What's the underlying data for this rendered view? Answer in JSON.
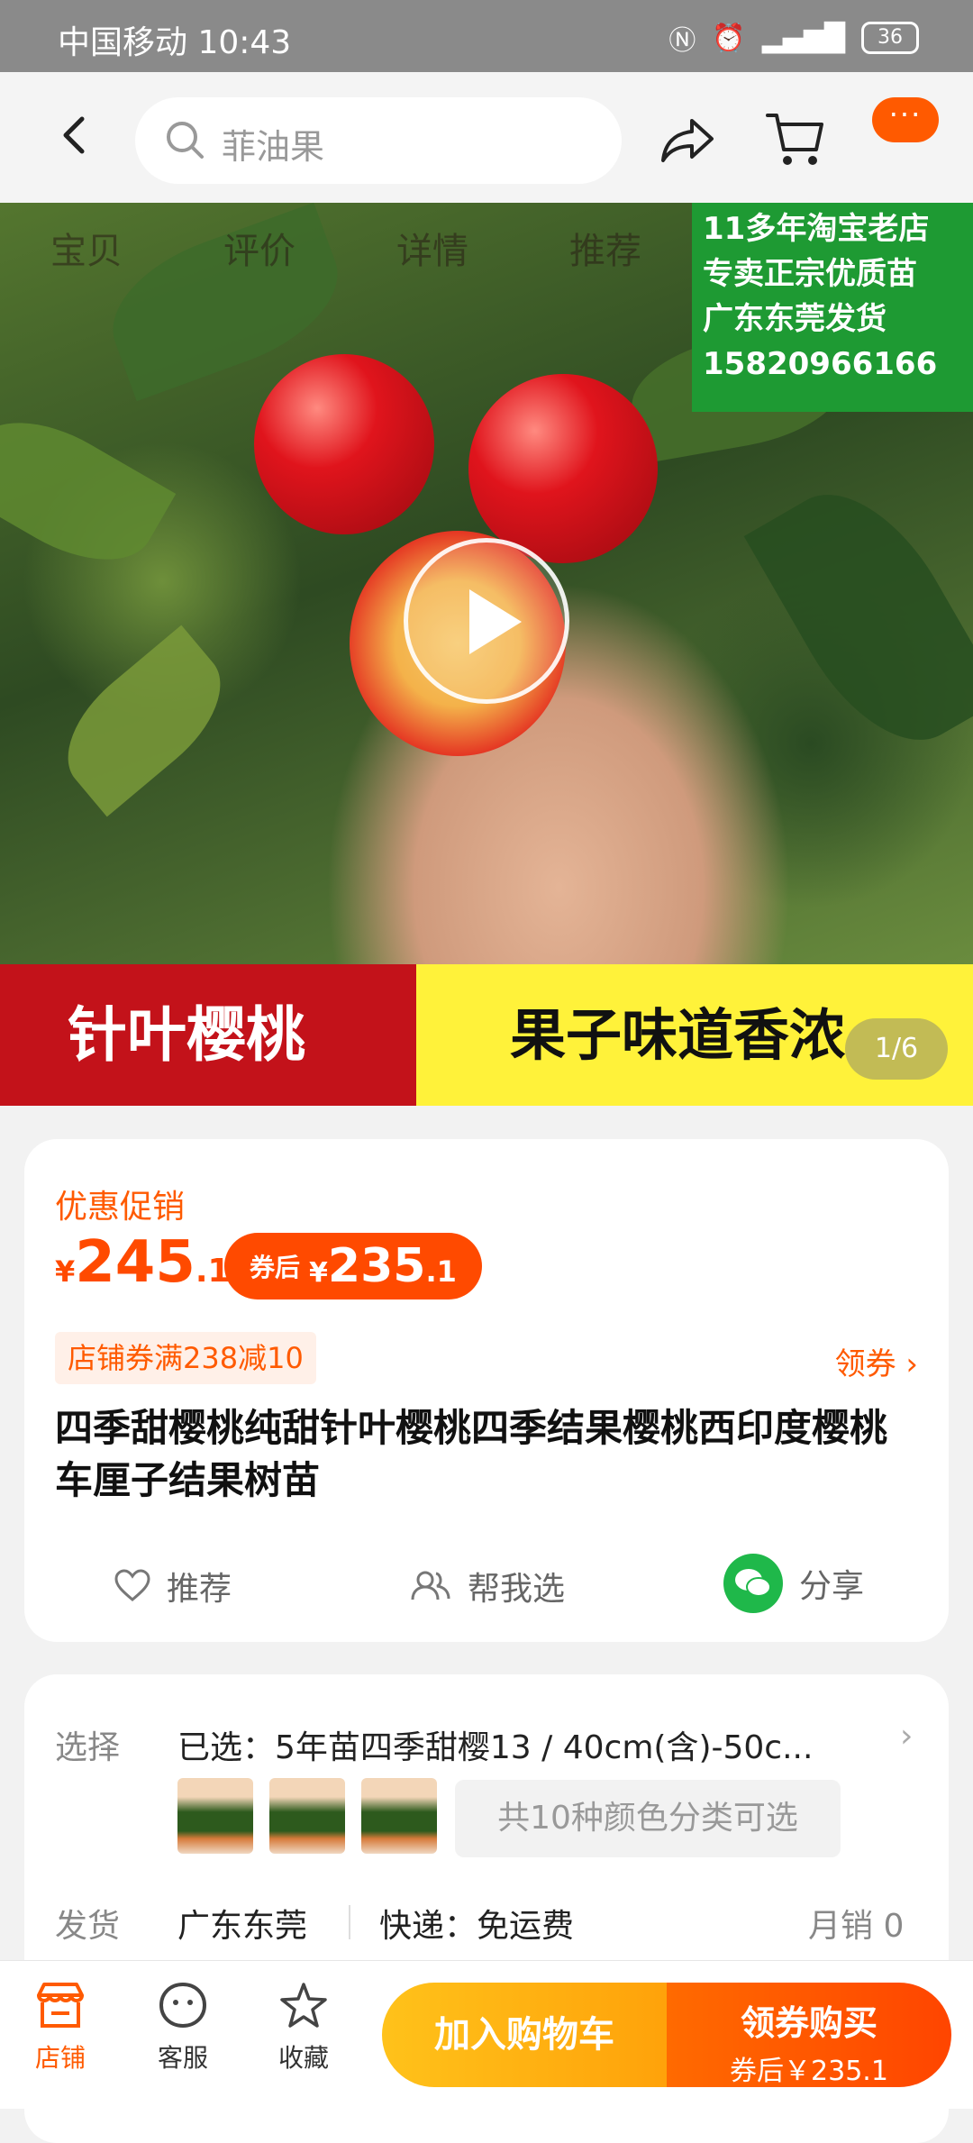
{
  "status_bar": {
    "carrier_time": "中国移动 10:43",
    "battery": "36"
  },
  "search": {
    "query": "菲油果"
  },
  "more_button": "···",
  "hero": {
    "tabs": [
      "宝贝",
      "评价",
      "详情",
      "推荐"
    ],
    "shop_ad_lines": [
      "11多年淘宝老店",
      "专卖正宗优质苗",
      "广东东莞发货",
      "15820966166"
    ],
    "banner_left": "针叶樱桃",
    "banner_right": "果子味道香浓",
    "page_indicator": "1/6"
  },
  "product": {
    "promo_label": "优惠促销",
    "price_symbol": "¥",
    "price_main": "245",
    "price_decimal": ".1",
    "after_coupon_label": "券后",
    "after_coupon_symbol": "¥",
    "after_coupon_main": "235",
    "after_coupon_decimal": ".1",
    "shop_coupon": "店铺券满238减10",
    "claim_coupon": "领券",
    "title": "四季甜樱桃纯甜针叶樱桃四季结果樱桃西印度樱桃车厘子结果树苗",
    "actions": {
      "recommend": "推荐",
      "help_choose": "帮我选",
      "share": "分享"
    }
  },
  "selection": {
    "select_label": "选择",
    "selected_value": "已选：5年苗四季甜樱13 / 40cm(含)-50c...",
    "variants_text": "共10种颜色分类可选",
    "ship_label": "发货",
    "ship_from": "广东东莞",
    "delivery": "快递：免运费",
    "monthly_sales": "月销  0"
  },
  "bottom_bar": {
    "store": "店铺",
    "service": "客服",
    "favorite": "收藏",
    "add_to_cart": "加入购物车",
    "buy_label": "领券购买",
    "buy_price": "券后￥235.1"
  },
  "colors": {
    "accent": "#ff5a00",
    "price": "#ff4a00",
    "cart_button": "#ffb012",
    "wechat": "#1fb84a"
  }
}
